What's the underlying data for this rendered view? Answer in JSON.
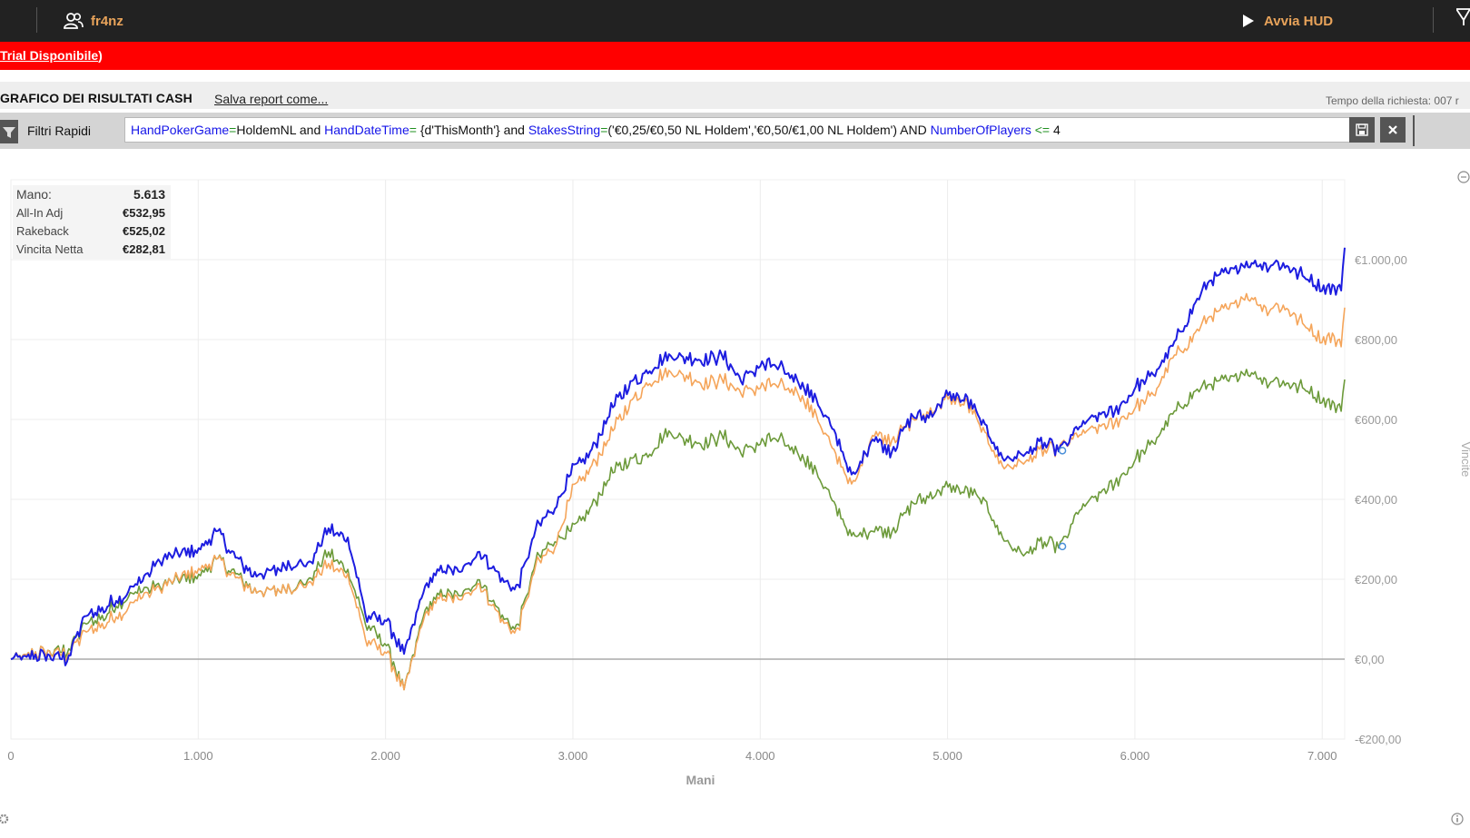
{
  "topbar": {
    "user_name": "fr4nz",
    "hud_label": "Avvia HUD"
  },
  "trial_banner": {
    "link_text": "Trial Disponibile",
    "suffix": ")"
  },
  "report": {
    "title": "GRAFICO DEI RISULTATI CASH",
    "save_link": "Salva report come...",
    "request_time": "Tempo della richiesta: 007 r"
  },
  "filter": {
    "label": "Filtri Rapidi",
    "query_tokens": [
      {
        "t": "field",
        "v": "HandPokerGame"
      },
      {
        "t": "op",
        "v": "="
      },
      {
        "t": "text",
        "v": "HoldemNL and "
      },
      {
        "t": "field",
        "v": "HandDateTime"
      },
      {
        "t": "op",
        "v": "="
      },
      {
        "t": "text",
        "v": " {d'ThisMonth'} and "
      },
      {
        "t": "field",
        "v": "StakesString"
      },
      {
        "t": "op",
        "v": "="
      },
      {
        "t": "text",
        "v": "('€0,25/€0,50 NL Holdem','€0,50/€1,00 NL Holdem') AND "
      },
      {
        "t": "field",
        "v": "NumberOfPlayers"
      },
      {
        "t": "op",
        "v": " <= "
      },
      {
        "t": "text",
        "v": "4"
      }
    ]
  },
  "summary": [
    {
      "label": "Mano:",
      "value": "5.613"
    },
    {
      "label": "All-In Adj",
      "value": "€532,95"
    },
    {
      "label": "Rakeback",
      "value": "€525,02"
    },
    {
      "label": "Vincita Netta",
      "value": "€282,81"
    }
  ],
  "colors": {
    "allin": "#1d1de0",
    "rakeback": "#f5a55a",
    "net": "#6c9a3a",
    "zero_line": "#aaaaaa",
    "grid": "#ececec",
    "accent": "#e8a35a",
    "banner": "#ff0000"
  },
  "chart_data": {
    "type": "line",
    "xlabel": "Mani",
    "ylabel": "Vincite",
    "xlim": [
      0,
      7120
    ],
    "ylim": [
      -200,
      1200
    ],
    "x_ticks": [
      0,
      1000,
      2000,
      3000,
      4000,
      5000,
      6000,
      7000
    ],
    "x_tick_labels": [
      "0",
      "1.000",
      "2.000",
      "3.000",
      "4.000",
      "5.000",
      "6.000",
      "7.000"
    ],
    "y_ticks": [
      -200,
      0,
      200,
      400,
      600,
      800,
      1000
    ],
    "y_tick_labels": [
      "-€200,00",
      "€0,00",
      "€200,00",
      "€400,00",
      "€600,00",
      "€800,00",
      "€1.000,00"
    ],
    "series": [
      {
        "key": "allin",
        "x": [
          0,
          200,
          300,
          400,
          500,
          600,
          700,
          800,
          900,
          1000,
          1100,
          1200,
          1300,
          1400,
          1500,
          1600,
          1700,
          1800,
          1900,
          2000,
          2100,
          2200,
          2300,
          2400,
          2500,
          2600,
          2700,
          2800,
          2900,
          3000,
          3100,
          3200,
          3300,
          3400,
          3500,
          3600,
          3700,
          3800,
          3900,
          4000,
          4100,
          4200,
          4300,
          4400,
          4500,
          4600,
          4700,
          4800,
          4900,
          5000,
          5100,
          5200,
          5300,
          5400,
          5500,
          5613,
          5700,
          5800,
          5900,
          6000,
          6100,
          6200,
          6300,
          6400,
          6500,
          6600,
          6700,
          6800,
          6900,
          7000,
          7050,
          7100,
          7120
        ],
        "y": [
          0,
          10,
          0,
          110,
          130,
          160,
          200,
          250,
          260,
          275,
          320,
          250,
          210,
          220,
          240,
          240,
          330,
          300,
          100,
          100,
          10,
          170,
          230,
          220,
          270,
          210,
          170,
          320,
          380,
          470,
          520,
          620,
          690,
          720,
          760,
          755,
          750,
          760,
          700,
          735,
          730,
          700,
          650,
          560,
          450,
          560,
          520,
          600,
          610,
          660,
          650,
          580,
          500,
          510,
          540,
          522,
          580,
          610,
          620,
          680,
          710,
          780,
          870,
          950,
          970,
          990,
          990,
          985,
          960,
          930,
          930,
          930,
          1030
        ]
      },
      {
        "key": "rakeback",
        "x": [
          0,
          200,
          300,
          400,
          500,
          600,
          700,
          800,
          900,
          1000,
          1100,
          1200,
          1300,
          1400,
          1500,
          1600,
          1700,
          1800,
          1900,
          2000,
          2100,
          2200,
          2300,
          2400,
          2500,
          2600,
          2700,
          2800,
          2900,
          3000,
          3100,
          3200,
          3300,
          3400,
          3500,
          3600,
          3700,
          3800,
          3900,
          4000,
          4100,
          4200,
          4300,
          4400,
          4500,
          4600,
          4700,
          4800,
          4900,
          5000,
          5100,
          5200,
          5300,
          5400,
          5500,
          5613,
          5700,
          5800,
          5900,
          6000,
          6100,
          6200,
          6300,
          6400,
          6500,
          6600,
          6700,
          6800,
          6900,
          7000,
          7050,
          7100,
          7120
        ],
        "y": [
          0,
          20,
          10,
          70,
          90,
          120,
          160,
          180,
          200,
          225,
          250,
          200,
          170,
          170,
          180,
          190,
          240,
          210,
          40,
          20,
          -80,
          100,
          160,
          150,
          190,
          110,
          60,
          230,
          280,
          420,
          480,
          560,
          640,
          690,
          720,
          710,
          690,
          700,
          670,
          680,
          685,
          670,
          610,
          510,
          430,
          570,
          550,
          590,
          620,
          650,
          640,
          560,
          480,
          490,
          520,
          528,
          560,
          580,
          590,
          630,
          660,
          750,
          800,
          860,
          880,
          910,
          880,
          880,
          840,
          800,
          810,
          790,
          880
        ]
      },
      {
        "key": "net",
        "x": [
          0,
          200,
          300,
          400,
          500,
          600,
          700,
          800,
          900,
          1000,
          1100,
          1200,
          1300,
          1400,
          1500,
          1600,
          1700,
          1800,
          1900,
          2000,
          2100,
          2200,
          2300,
          2400,
          2500,
          2600,
          2700,
          2800,
          2900,
          3000,
          3100,
          3200,
          3300,
          3400,
          3500,
          3600,
          3700,
          3800,
          3900,
          4000,
          4100,
          4200,
          4300,
          4400,
          4500,
          4600,
          4700,
          4800,
          4900,
          5000,
          5100,
          5200,
          5300,
          5400,
          5500,
          5613,
          5700,
          5800,
          5900,
          6000,
          6100,
          6200,
          6300,
          6400,
          6500,
          6600,
          6700,
          6800,
          6900,
          7000,
          7050,
          7100,
          7120
        ],
        "y": [
          0,
          20,
          20,
          90,
          110,
          150,
          175,
          185,
          195,
          210,
          250,
          210,
          170,
          170,
          180,
          200,
          270,
          220,
          80,
          40,
          -80,
          110,
          170,
          160,
          200,
          120,
          70,
          240,
          300,
          320,
          380,
          460,
          500,
          510,
          570,
          550,
          540,
          560,
          520,
          540,
          550,
          520,
          470,
          380,
          300,
          330,
          320,
          380,
          410,
          430,
          420,
          390,
          300,
          260,
          290,
          282,
          370,
          410,
          440,
          500,
          540,
          610,
          660,
          690,
          700,
          720,
          700,
          690,
          680,
          650,
          640,
          630,
          700
        ]
      }
    ]
  }
}
